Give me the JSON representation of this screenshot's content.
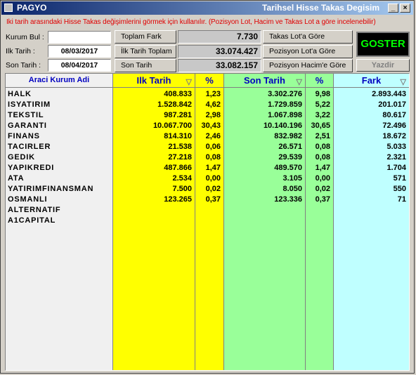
{
  "window": {
    "title": "PAGYO",
    "title_right": "Tarihsel Hisse Takas Degisim"
  },
  "info_text": "Iki tarih arasındaki Hisse Takas değişimlerini görmek için kullanılır. (Pozisyon Lot, Hacim ve Takas Lot a göre incelenebilir)",
  "filters": {
    "kurum_bul_label": "Kurum Bul :",
    "kurum_bul_value": "",
    "ilk_tarih_label": "Ilk Tarih    :",
    "ilk_tarih_value": "08/03/2017",
    "son_tarih_label": "Son Tarih   :",
    "son_tarih_value": "08/04/2017"
  },
  "summary": {
    "toplam_fark_label": "Toplam Fark",
    "toplam_fark_value": "7.730",
    "ilk_tarih_toplam_label": "İlk Tarih Toplam",
    "ilk_tarih_toplam_value": "33.074.427",
    "son_tarih_toplam_label": "Son Tarih Toplam",
    "son_tarih_toplam_value": "33.082.157"
  },
  "sort_buttons": {
    "takas_lot": "Takas Lot'a Göre",
    "pozisyon_lot": "Pozisyon Lot'a Göre",
    "pozisyon_hacim": "Pozisyon Hacim'e Göre"
  },
  "actions": {
    "goster": "GOSTER",
    "yazdir": "Yazdir"
  },
  "columns": {
    "kurum": "Araci Kurum Adi",
    "ilk_tarih": "Ilk Tarih",
    "ilk_pct": "%",
    "son_tarih": "Son Tarih",
    "son_pct": "%",
    "fark": "Fark"
  },
  "colors": {
    "ilk": "#ffff00",
    "son": "#99ff99",
    "fark": "#bfffff",
    "info": "#e00000",
    "header": "#0000c0"
  },
  "rows": [
    {
      "kurum": "HALK",
      "ilk": "408.833",
      "ilk_pct": "1,23",
      "son": "3.302.276",
      "son_pct": "9,98",
      "fark": "2.893.443"
    },
    {
      "kurum": "ISYATIRIM",
      "ilk": "1.528.842",
      "ilk_pct": "4,62",
      "son": "1.729.859",
      "son_pct": "5,22",
      "fark": "201.017"
    },
    {
      "kurum": "TEKSTIL",
      "ilk": "987.281",
      "ilk_pct": "2,98",
      "son": "1.067.898",
      "son_pct": "3,22",
      "fark": "80.617"
    },
    {
      "kurum": "GARANTI",
      "ilk": "10.067.700",
      "ilk_pct": "30,43",
      "son": "10.140.196",
      "son_pct": "30,65",
      "fark": "72.496"
    },
    {
      "kurum": "FINANS",
      "ilk": "814.310",
      "ilk_pct": "2,46",
      "son": "832.982",
      "son_pct": "2,51",
      "fark": "18.672"
    },
    {
      "kurum": "TACIRLER",
      "ilk": "21.538",
      "ilk_pct": "0,06",
      "son": "26.571",
      "son_pct": "0,08",
      "fark": "5.033"
    },
    {
      "kurum": "GEDIK",
      "ilk": "27.218",
      "ilk_pct": "0,08",
      "son": "29.539",
      "son_pct": "0,08",
      "fark": "2.321"
    },
    {
      "kurum": "YAPIKREDI",
      "ilk": "487.866",
      "ilk_pct": "1,47",
      "son": "489.570",
      "son_pct": "1,47",
      "fark": "1.704"
    },
    {
      "kurum": "ATA",
      "ilk": "2.534",
      "ilk_pct": "0,00",
      "son": "3.105",
      "son_pct": "0,00",
      "fark": "571"
    },
    {
      "kurum": "YATIRIMFINANSMAN",
      "ilk": "7.500",
      "ilk_pct": "0,02",
      "son": "8.050",
      "son_pct": "0,02",
      "fark": "550"
    },
    {
      "kurum": "OSMANLI",
      "ilk": "123.265",
      "ilk_pct": "0,37",
      "son": "123.336",
      "son_pct": "0,37",
      "fark": "71"
    },
    {
      "kurum": "ALTERNATIF",
      "ilk": "",
      "ilk_pct": "",
      "son": "",
      "son_pct": "",
      "fark": ""
    },
    {
      "kurum": "A1CAPITAL",
      "ilk": "",
      "ilk_pct": "",
      "son": "",
      "son_pct": "",
      "fark": ""
    }
  ]
}
